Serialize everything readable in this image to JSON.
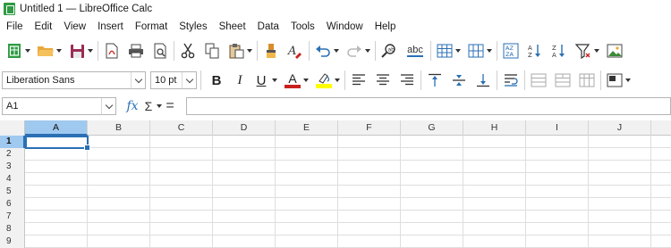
{
  "window": {
    "title": "Untitled 1 — LibreOffice Calc"
  },
  "menu": [
    "File",
    "Edit",
    "View",
    "Insert",
    "Format",
    "Styles",
    "Sheet",
    "Data",
    "Tools",
    "Window",
    "Help"
  ],
  "format_toolbar": {
    "font_name": "Liberation Sans",
    "font_size": "10 pt",
    "bold": "B",
    "italic": "I",
    "underline": "U",
    "font_color_letter": "A"
  },
  "standard_toolbar": {
    "spelling_label": "abc",
    "sort_ascending_label": "A Z",
    "sort_descending_label": "Z A"
  },
  "formula_bar": {
    "name_box": "A1",
    "fx_label": "fx",
    "sigma_label": "Σ",
    "equals_label": "=",
    "formula": ""
  },
  "grid": {
    "columns": [
      "A",
      "B",
      "C",
      "D",
      "E",
      "F",
      "G",
      "H",
      "I",
      "J"
    ],
    "rows": [
      "1",
      "2",
      "3",
      "4",
      "5",
      "6",
      "7",
      "8",
      "9"
    ],
    "active_cell": "A1"
  },
  "colors": {
    "accent": "#2a6fb5",
    "header_highlight": "#9fc9ef",
    "font_color_bar": "#c9211e",
    "highlight_color_bar": "#ffff00",
    "calc_green": "#2f9b43"
  }
}
